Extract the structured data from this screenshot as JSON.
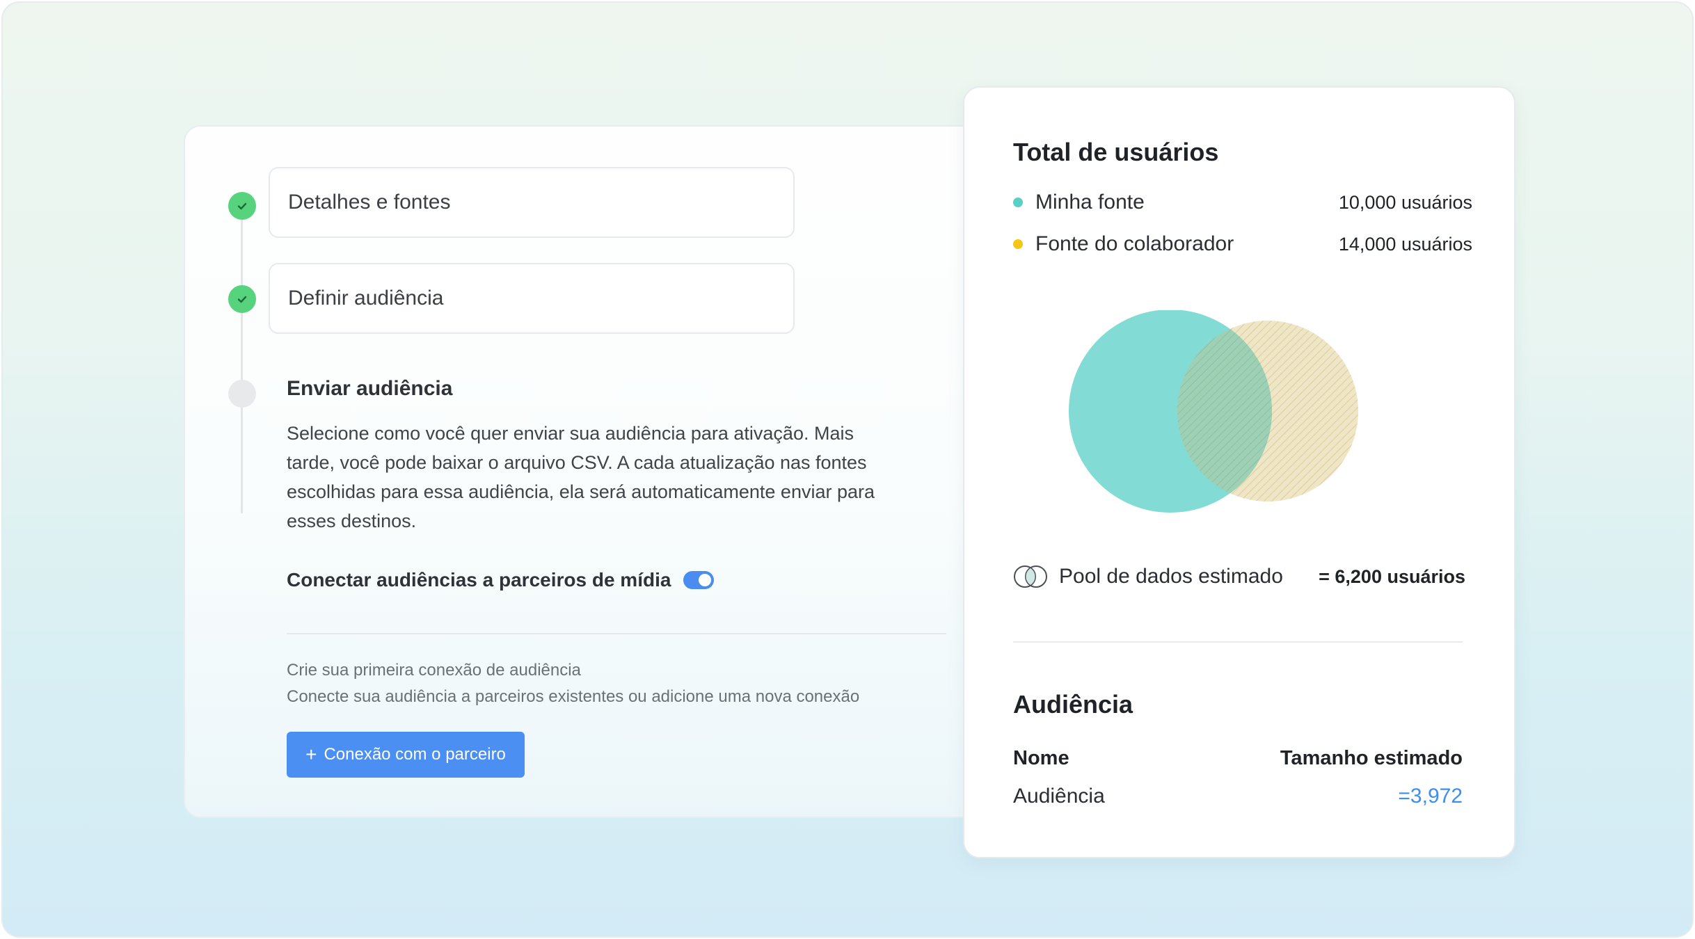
{
  "steps": [
    {
      "label": "Detalhes e fontes",
      "status": "done"
    },
    {
      "label": "Definir audiência",
      "status": "done"
    },
    {
      "label": "Enviar audiência",
      "status": "active"
    }
  ],
  "active_step": {
    "description": "Selecione como você quer enviar sua audiência para ativação. Mais tarde, você pode baixar o arquivo CSV. A cada atualização nas fontes escolhidas para essa audiência, ela será automaticamente enviar para esses destinos.",
    "toggle_label": "Conectar audiências a parceiros de mídia",
    "toggle_on": true,
    "hint_title": "Crie sua primeira conexão de audiência",
    "hint_body": "Conecte sua audiência a parceiros existentes ou adicione uma nova conexão",
    "partner_button": "Conexão com o parceiro"
  },
  "icons": {
    "check": "check-icon",
    "plus": "plus-icon",
    "overlap": "venn-overlap-icon"
  },
  "totals": {
    "title": "Total de usuários",
    "sources": [
      {
        "name": "Minha fonte",
        "value": "10,000 usuários",
        "color": "#5ccfc4"
      },
      {
        "name": "Fonte do colaborador",
        "value": "14,000 usuários",
        "color": "#f5c518"
      }
    ],
    "pool_label": "Pool de dados estimado",
    "pool_value": "= 6,200 usuários"
  },
  "audience": {
    "title": "Audiência",
    "col_name": "Nome",
    "col_size": "Tamanho estimado",
    "rows": [
      {
        "name": "Audiência",
        "size": "=3,972"
      }
    ]
  },
  "colors": {
    "accent": "#4b8ff2",
    "done": "#56d37c",
    "teal": "#7fdad4",
    "sand": "#ece3c4"
  }
}
